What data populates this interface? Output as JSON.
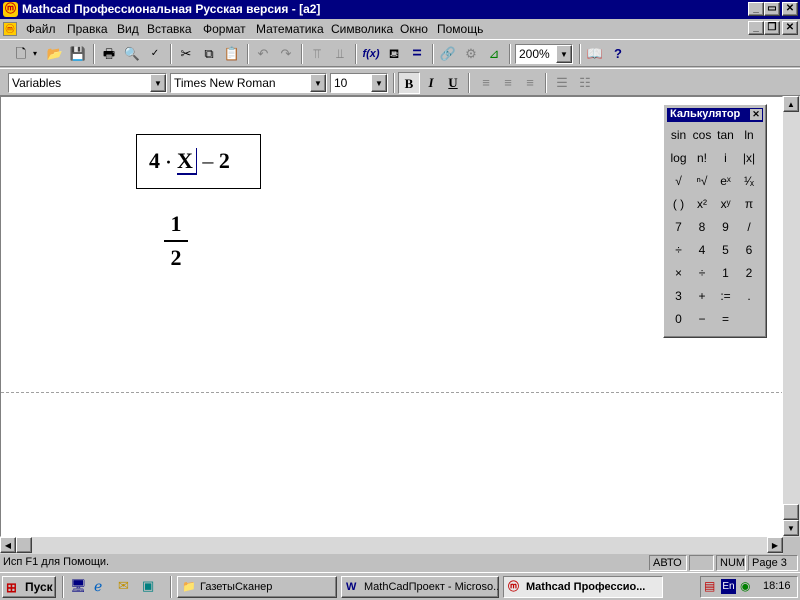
{
  "window": {
    "title": "Mathcad Профессиональная Русская версия - [a2]"
  },
  "menu": [
    "Файл",
    "Правка",
    "Вид",
    "Вставка",
    "Формат",
    "Математика",
    "Символика",
    "Окно",
    "Помощь"
  ],
  "toolbar": {
    "zoom": "200%"
  },
  "format": {
    "style": "Variables",
    "font": "Times New Roman",
    "size": "10",
    "bold": "B",
    "italic": "I",
    "underline": "U"
  },
  "document": {
    "expr": {
      "coef": "4",
      "dot": "·",
      "var": "X",
      "minus": "–",
      "const": "2"
    },
    "result": {
      "num": "1",
      "den": "2"
    }
  },
  "calculator": {
    "title": "Калькулятор",
    "buttons": [
      "sin",
      "cos",
      "tan",
      "ln",
      "log",
      "n!",
      "i",
      "|x|",
      "√",
      "ⁿ√",
      "eˣ",
      "¹⁄ₓ",
      "( )",
      "x²",
      "xʸ",
      "π",
      "7",
      "8",
      "9",
      "/",
      "÷",
      "4",
      "5",
      "6",
      "×",
      "÷",
      "1",
      "2",
      "3",
      "+",
      ":=",
      ".",
      "0",
      "−",
      "=",
      ""
    ]
  },
  "status": {
    "help": "Исп F1 для Помощи.",
    "mode": "АВТО",
    "num": "NUM",
    "page": "Page 3"
  },
  "taskbar": {
    "start": "Пуск",
    "tasks": [
      "ГазетыСканер",
      "MathCadПроект - Microso...",
      "Mathcad Профессио..."
    ],
    "lang": "En",
    "time": "18:16"
  },
  "colors": {
    "titlebar": "#000080",
    "face": "#c0c0c0",
    "doc": "#ffffff"
  }
}
